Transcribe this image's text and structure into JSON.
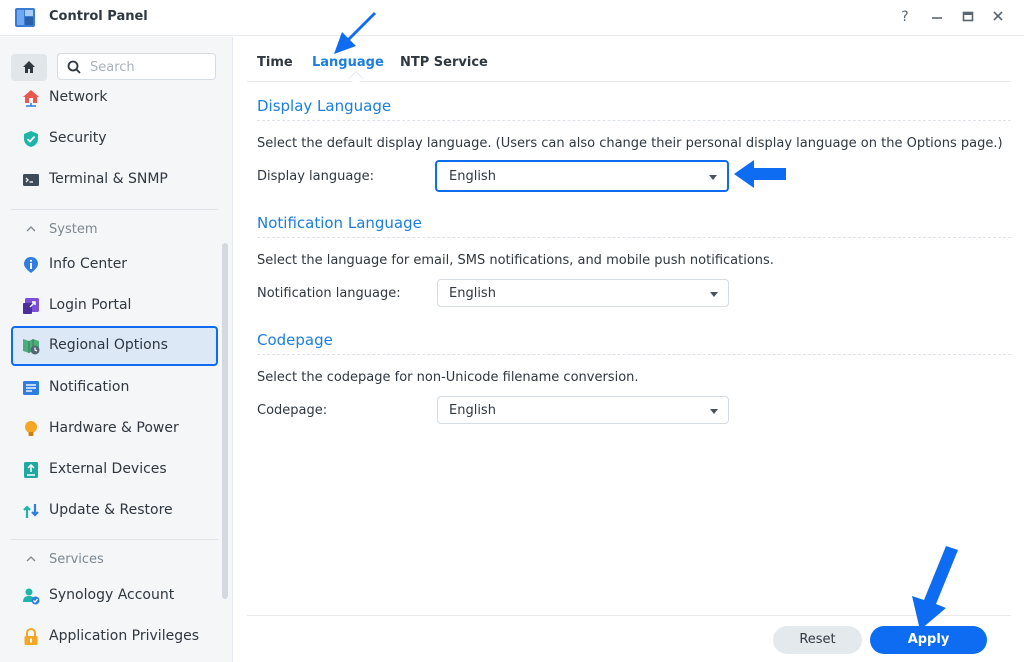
{
  "window": {
    "title": "Control Panel",
    "controls": [
      "help-icon",
      "minimize-icon",
      "maximize-icon",
      "close-icon"
    ]
  },
  "sidebar": {
    "search": {
      "placeholder": "Search",
      "value": ""
    },
    "items_top": [
      {
        "label": "Network",
        "icon": "network-house-icon"
      },
      {
        "label": "Security",
        "icon": "shield-check-icon"
      },
      {
        "label": "Terminal & SNMP",
        "icon": "terminal-icon"
      }
    ],
    "group_system": "System",
    "items_system": [
      {
        "label": "Info Center",
        "icon": "info-icon"
      },
      {
        "label": "Login Portal",
        "icon": "login-portal-icon"
      },
      {
        "label": "Regional Options",
        "icon": "regional-options-icon",
        "selected": true
      },
      {
        "label": "Notification",
        "icon": "notification-icon"
      },
      {
        "label": "Hardware & Power",
        "icon": "lightbulb-icon"
      },
      {
        "label": "External Devices",
        "icon": "external-device-icon"
      },
      {
        "label": "Update & Restore",
        "icon": "update-restore-icon"
      }
    ],
    "group_services": "Services",
    "items_services": [
      {
        "label": "Synology Account",
        "icon": "account-icon"
      },
      {
        "label": "Application Privileges",
        "icon": "lock-icon"
      }
    ]
  },
  "tabs": [
    {
      "label": "Time"
    },
    {
      "label": "Language",
      "active": true
    },
    {
      "label": "NTP Service"
    }
  ],
  "sections": {
    "display": {
      "title": "Display Language",
      "description": "Select the default display language. (Users can also change their personal display language on the Options page.)",
      "field_label": "Display language:",
      "value": "English"
    },
    "notification": {
      "title": "Notification Language",
      "description": "Select the language for email, SMS notifications, and mobile push notifications.",
      "field_label": "Notification language:",
      "value": "English"
    },
    "codepage": {
      "title": "Codepage",
      "description": "Select the codepage for non-Unicode filename conversion.",
      "field_label": "Codepage:",
      "value": "English"
    }
  },
  "footer": {
    "reset_label": "Reset",
    "apply_label": "Apply"
  },
  "colors": {
    "accent": "#0d6cf2",
    "link_blue": "#1b7ee0",
    "sidebar_bg": "#f4f6f8"
  }
}
